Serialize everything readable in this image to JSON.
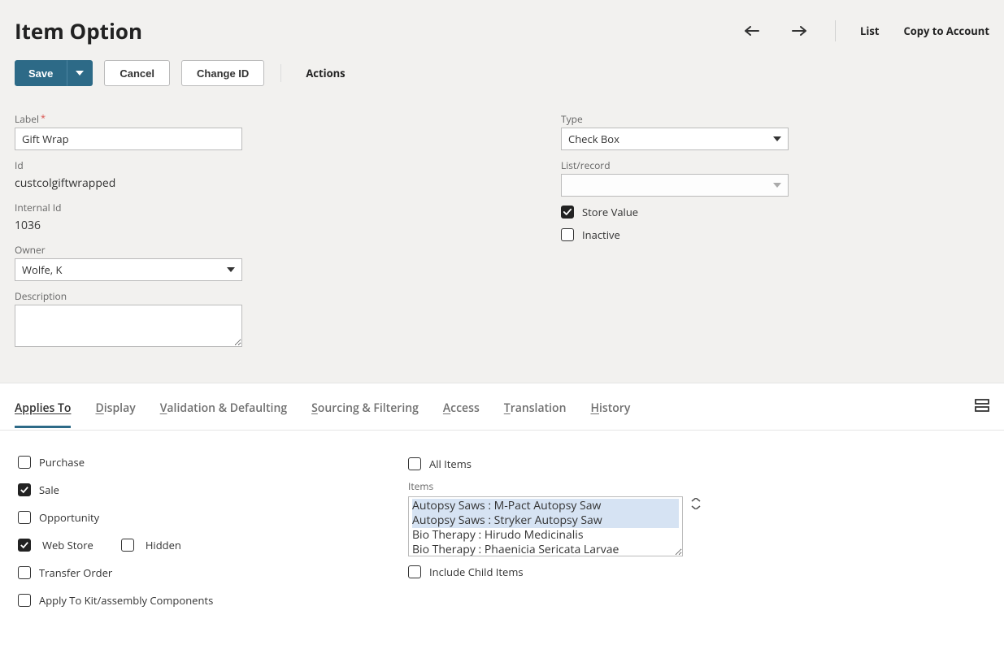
{
  "page_title": "Item Option",
  "top_actions": {
    "list": "List",
    "copy": "Copy to Account"
  },
  "toolbar": {
    "save": "Save",
    "cancel": "Cancel",
    "change_id": "Change ID",
    "actions": "Actions"
  },
  "form": {
    "left": {
      "label_label": "Label",
      "label_value": "Gift Wrap",
      "id_label": "Id",
      "id_value": "custcolgiftwrapped",
      "internal_id_label": "Internal Id",
      "internal_id_value": "1036",
      "owner_label": "Owner",
      "owner_value": "Wolfe, K",
      "description_label": "Description",
      "description_value": ""
    },
    "right": {
      "type_label": "Type",
      "type_value": "Check Box",
      "list_record_label": "List/record",
      "list_record_value": "",
      "store_value_label": "Store Value",
      "store_value_checked": true,
      "inactive_label": "Inactive",
      "inactive_checked": false
    }
  },
  "tabs": {
    "applies_to": "Applies To",
    "display": "Display",
    "validation": "Validation & Defaulting",
    "sourcing": "Sourcing & Filtering",
    "access": "Access",
    "translation": "Translation",
    "history": "History"
  },
  "applies_to": {
    "purchase": "Purchase",
    "sale": "Sale",
    "opportunity": "Opportunity",
    "web_store": "Web Store",
    "hidden": "Hidden",
    "transfer_order": "Transfer Order",
    "apply_kit": "Apply To Kit/assembly Components",
    "all_items": "All Items",
    "items_label": "Items",
    "include_child": "Include Child Items",
    "items": [
      "Autopsy Saws : M-Pact Autopsy Saw",
      "Autopsy Saws : Stryker Autopsy Saw",
      "Bio Therapy : Hirudo Medicinalis",
      "Bio Therapy : Phaenicia Sericata Larvae"
    ],
    "checked": {
      "purchase": false,
      "sale": true,
      "opportunity": false,
      "web_store": true,
      "hidden": false,
      "transfer_order": false,
      "apply_kit": false,
      "all_items": false,
      "include_child": false
    }
  }
}
